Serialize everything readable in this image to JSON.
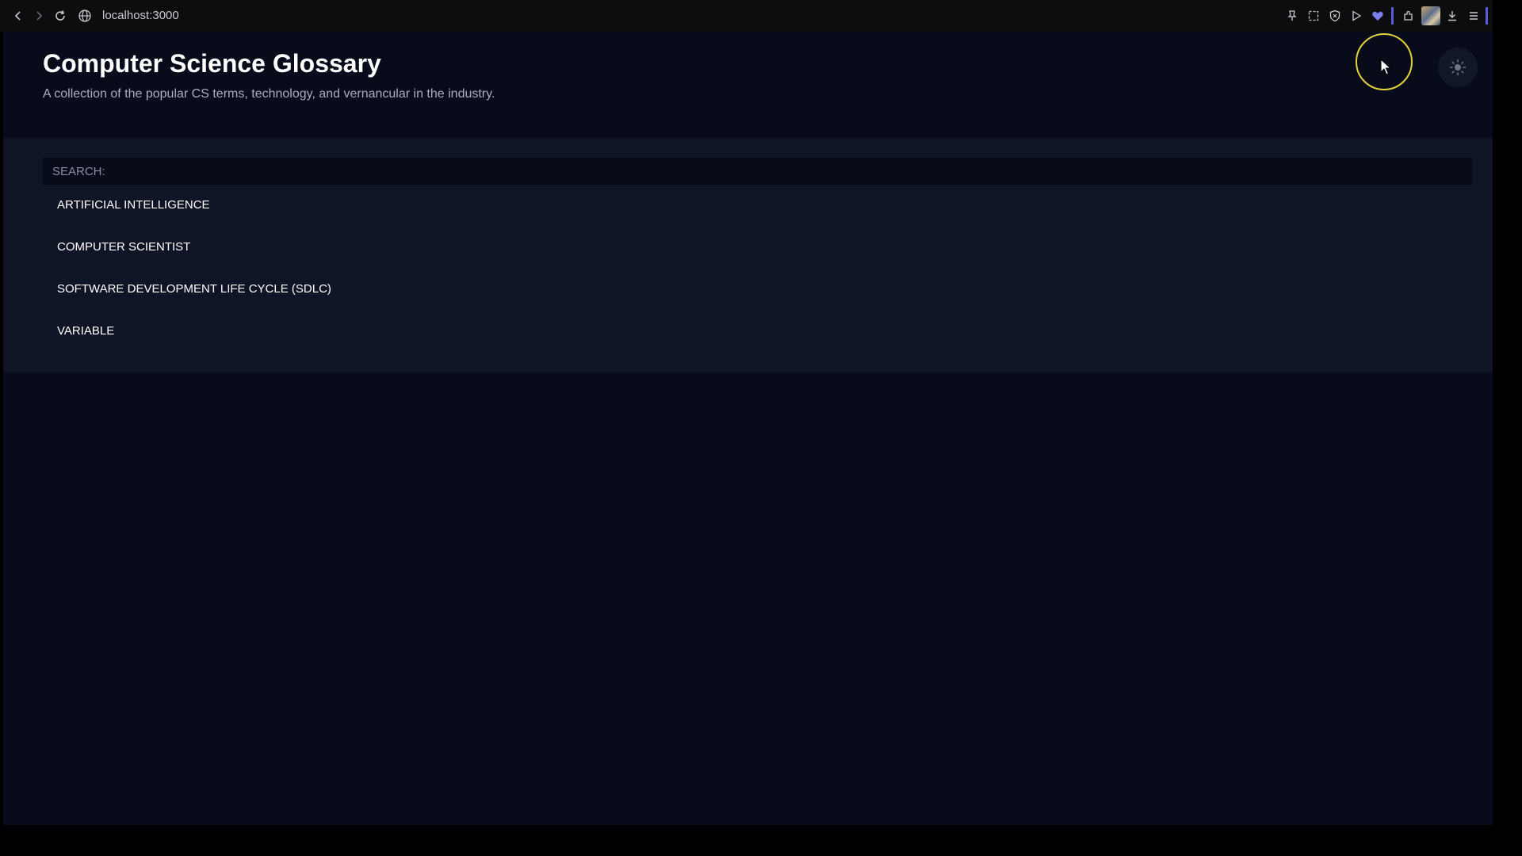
{
  "browser": {
    "url": "localhost:3000",
    "icons": [
      "back-icon",
      "forward-icon",
      "reload-icon",
      "globe-icon",
      "pin-icon",
      "screenshot-icon",
      "shield-icon",
      "play-icon",
      "heart-icon",
      "extensions-icon",
      "download-icon",
      "menu-icon"
    ],
    "accent_color": "#5b5bd6"
  },
  "header": {
    "title": "Computer Science Glossary",
    "subtitle": "A collection of the popular CS terms, technology, and vernancular in the industry.",
    "theme_toggle_icon": "sun-icon"
  },
  "search": {
    "placeholder": "SEARCH:",
    "value": ""
  },
  "terms": [
    "ARTIFICIAL INTELLIGENCE",
    "COMPUTER SCIENTIST",
    "SOFTWARE DEVELOPMENT LIFE CYCLE (SDLC)",
    "VARIABLE"
  ],
  "colors": {
    "page_background": "#070b1a",
    "panel_background": "#101526",
    "cursor_highlight": "#e3d23a"
  }
}
